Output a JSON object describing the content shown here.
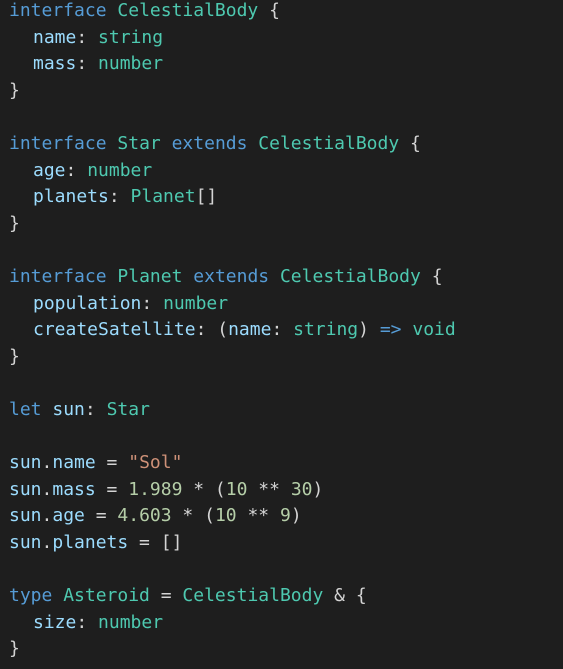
{
  "colors": {
    "background": "#1e1e1e",
    "keyword": "#569cd6",
    "type": "#4ec9b0",
    "property": "#9cdcfe",
    "text": "#d4d4d4",
    "string": "#ce9178",
    "number": "#b5cea8",
    "guide": "#404040"
  },
  "code": {
    "lines": [
      {
        "indent": 0,
        "tokens": [
          {
            "t": "interface",
            "c": "keyword"
          },
          {
            "t": " ",
            "c": "text"
          },
          {
            "t": "CelestialBody",
            "c": "type"
          },
          {
            "t": " {",
            "c": "text"
          }
        ]
      },
      {
        "indent": 1,
        "tokens": [
          {
            "t": "name",
            "c": "property"
          },
          {
            "t": ": ",
            "c": "text"
          },
          {
            "t": "string",
            "c": "type"
          }
        ]
      },
      {
        "indent": 1,
        "tokens": [
          {
            "t": "mass",
            "c": "property"
          },
          {
            "t": ": ",
            "c": "text"
          },
          {
            "t": "number",
            "c": "type"
          }
        ]
      },
      {
        "indent": 0,
        "tokens": [
          {
            "t": "}",
            "c": "text"
          }
        ]
      },
      {
        "indent": 0,
        "tokens": []
      },
      {
        "indent": 0,
        "tokens": [
          {
            "t": "interface",
            "c": "keyword"
          },
          {
            "t": " ",
            "c": "text"
          },
          {
            "t": "Star",
            "c": "type"
          },
          {
            "t": " ",
            "c": "text"
          },
          {
            "t": "extends",
            "c": "keyword"
          },
          {
            "t": " ",
            "c": "text"
          },
          {
            "t": "CelestialBody",
            "c": "type"
          },
          {
            "t": " {",
            "c": "text"
          }
        ]
      },
      {
        "indent": 1,
        "tokens": [
          {
            "t": "age",
            "c": "property"
          },
          {
            "t": ": ",
            "c": "text"
          },
          {
            "t": "number",
            "c": "type"
          }
        ]
      },
      {
        "indent": 1,
        "tokens": [
          {
            "t": "planets",
            "c": "property"
          },
          {
            "t": ": ",
            "c": "text"
          },
          {
            "t": "Planet",
            "c": "type"
          },
          {
            "t": "[]",
            "c": "text"
          }
        ]
      },
      {
        "indent": 0,
        "tokens": [
          {
            "t": "}",
            "c": "text"
          }
        ]
      },
      {
        "indent": 0,
        "tokens": []
      },
      {
        "indent": 0,
        "tokens": [
          {
            "t": "interface",
            "c": "keyword"
          },
          {
            "t": " ",
            "c": "text"
          },
          {
            "t": "Planet",
            "c": "type"
          },
          {
            "t": " ",
            "c": "text"
          },
          {
            "t": "extends",
            "c": "keyword"
          },
          {
            "t": " ",
            "c": "text"
          },
          {
            "t": "CelestialBody",
            "c": "type"
          },
          {
            "t": " {",
            "c": "text"
          }
        ]
      },
      {
        "indent": 1,
        "tokens": [
          {
            "t": "population",
            "c": "property"
          },
          {
            "t": ": ",
            "c": "text"
          },
          {
            "t": "number",
            "c": "type"
          }
        ]
      },
      {
        "indent": 1,
        "tokens": [
          {
            "t": "createSatellite",
            "c": "property"
          },
          {
            "t": ": (",
            "c": "text"
          },
          {
            "t": "name",
            "c": "property"
          },
          {
            "t": ": ",
            "c": "text"
          },
          {
            "t": "string",
            "c": "type"
          },
          {
            "t": ") ",
            "c": "text"
          },
          {
            "t": "=>",
            "c": "keyword"
          },
          {
            "t": " ",
            "c": "text"
          },
          {
            "t": "void",
            "c": "type"
          }
        ]
      },
      {
        "indent": 0,
        "tokens": [
          {
            "t": "}",
            "c": "text"
          }
        ]
      },
      {
        "indent": 0,
        "tokens": []
      },
      {
        "indent": 0,
        "tokens": [
          {
            "t": "let",
            "c": "keyword"
          },
          {
            "t": " ",
            "c": "text"
          },
          {
            "t": "sun",
            "c": "property"
          },
          {
            "t": ": ",
            "c": "text"
          },
          {
            "t": "Star",
            "c": "type"
          }
        ]
      },
      {
        "indent": 0,
        "tokens": []
      },
      {
        "indent": 0,
        "tokens": [
          {
            "t": "sun",
            "c": "property"
          },
          {
            "t": ".",
            "c": "text"
          },
          {
            "t": "name",
            "c": "property"
          },
          {
            "t": " = ",
            "c": "text"
          },
          {
            "t": "\"Sol\"",
            "c": "string"
          }
        ]
      },
      {
        "indent": 0,
        "tokens": [
          {
            "t": "sun",
            "c": "property"
          },
          {
            "t": ".",
            "c": "text"
          },
          {
            "t": "mass",
            "c": "property"
          },
          {
            "t": " = ",
            "c": "text"
          },
          {
            "t": "1.989",
            "c": "number"
          },
          {
            "t": " * (",
            "c": "text"
          },
          {
            "t": "10",
            "c": "number"
          },
          {
            "t": " ** ",
            "c": "text"
          },
          {
            "t": "30",
            "c": "number"
          },
          {
            "t": ")",
            "c": "text"
          }
        ]
      },
      {
        "indent": 0,
        "tokens": [
          {
            "t": "sun",
            "c": "property"
          },
          {
            "t": ".",
            "c": "text"
          },
          {
            "t": "age",
            "c": "property"
          },
          {
            "t": " = ",
            "c": "text"
          },
          {
            "t": "4.603",
            "c": "number"
          },
          {
            "t": " * (",
            "c": "text"
          },
          {
            "t": "10",
            "c": "number"
          },
          {
            "t": " ** ",
            "c": "text"
          },
          {
            "t": "9",
            "c": "number"
          },
          {
            "t": ")",
            "c": "text"
          }
        ]
      },
      {
        "indent": 0,
        "tokens": [
          {
            "t": "sun",
            "c": "property"
          },
          {
            "t": ".",
            "c": "text"
          },
          {
            "t": "planets",
            "c": "property"
          },
          {
            "t": " = []",
            "c": "text"
          }
        ]
      },
      {
        "indent": 0,
        "tokens": []
      },
      {
        "indent": 0,
        "tokens": [
          {
            "t": "type",
            "c": "keyword"
          },
          {
            "t": " ",
            "c": "text"
          },
          {
            "t": "Asteroid",
            "c": "type"
          },
          {
            "t": " = ",
            "c": "text"
          },
          {
            "t": "CelestialBody",
            "c": "type"
          },
          {
            "t": " & {",
            "c": "text"
          }
        ]
      },
      {
        "indent": 1,
        "tokens": [
          {
            "t": "size",
            "c": "property"
          },
          {
            "t": ": ",
            "c": "text"
          },
          {
            "t": "number",
            "c": "type"
          }
        ]
      },
      {
        "indent": 0,
        "tokens": [
          {
            "t": "}",
            "c": "text"
          }
        ]
      }
    ]
  }
}
